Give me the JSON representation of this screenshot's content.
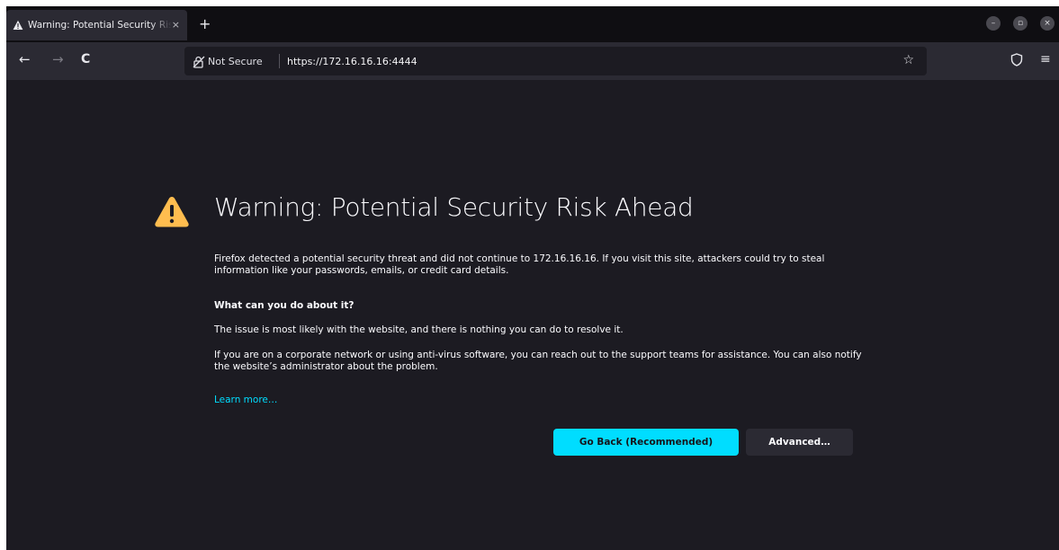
{
  "browser": {
    "tab": {
      "title": "Warning: Potential Security Risk Ahead",
      "close_glyph": "×"
    },
    "new_tab_glyph": "+",
    "window_controls": {
      "minimize": "–",
      "maximize": "▫",
      "close": "×"
    },
    "nav": {
      "back_glyph": "←",
      "forward_glyph": "→",
      "reload_glyph": "C"
    },
    "url_bar": {
      "security_label": "Not Secure",
      "url": "https://172.16.16.16:4444",
      "bookmark_glyph": "☆"
    },
    "menu_glyph": "≡"
  },
  "page": {
    "heading": "Warning: Potential Security Risk Ahead",
    "intro": "Firefox detected a potential security threat and did not continue to 172.16.16.16. If you visit this site, attackers could try to steal information like your passwords, emails, or credit card details.",
    "what_heading": "What can you do about it?",
    "issue_text": "The issue is most likely with the website, and there is nothing you can do to resolve it.",
    "corporate_text": "If you are on a corporate network or using anti-virus software, you can reach out to the support teams for assistance. You can also notify the website’s administrator about the problem.",
    "learn_more": "Learn more…",
    "go_back_label": "Go Back (Recommended)",
    "advanced_label": "Advanced…"
  },
  "colors": {
    "accent": "#00ddff",
    "warning": "#ffbd4f",
    "page_bg": "#1c1b22",
    "toolbar_bg": "#2b2a33"
  },
  "icons": {
    "tab": "warning-triangle-icon",
    "url_bar": "broken-lock-icon",
    "toolbar": "shield-icon",
    "page": "warning-triangle-icon"
  }
}
